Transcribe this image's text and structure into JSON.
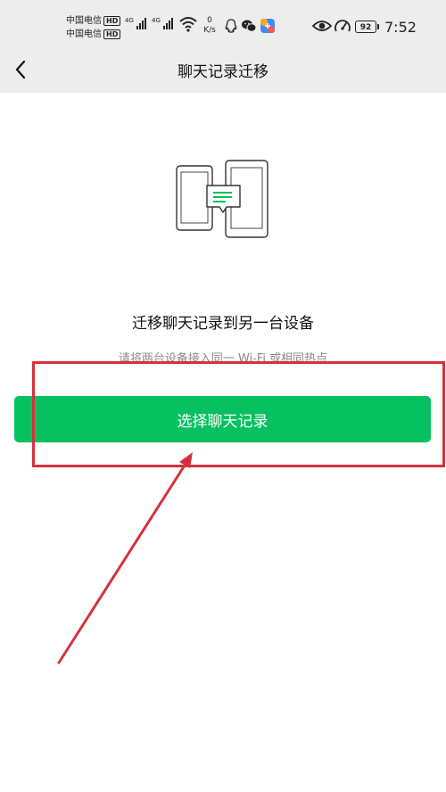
{
  "status_bar": {
    "carrier_1": "中国电信",
    "carrier_2": "中国电信",
    "hd_badge": "HD",
    "network_1": "4G",
    "network_2": "4G",
    "speed_value": "0",
    "speed_unit": "K/s",
    "battery": "92",
    "time": "7:52",
    "icons": [
      "signal-icon",
      "wifi-icon",
      "qq-icon",
      "wechat-icon",
      "app-icon",
      "eye-icon",
      "speedometer-icon",
      "battery-icon"
    ]
  },
  "nav": {
    "back_icon": "chevron-left-icon",
    "title": "聊天记录迁移"
  },
  "content": {
    "illustration_icon": "phone-transfer-icon",
    "headline": "迁移聊天记录到另一台设备",
    "subtext": "请将两台设备接入同一 Wi-Fi 或相同热点",
    "primary_button": "选择聊天记录"
  },
  "colors": {
    "topbar_bg": "#ededed",
    "accent_green": "#07c160",
    "annotation_red": "#d6313a"
  }
}
